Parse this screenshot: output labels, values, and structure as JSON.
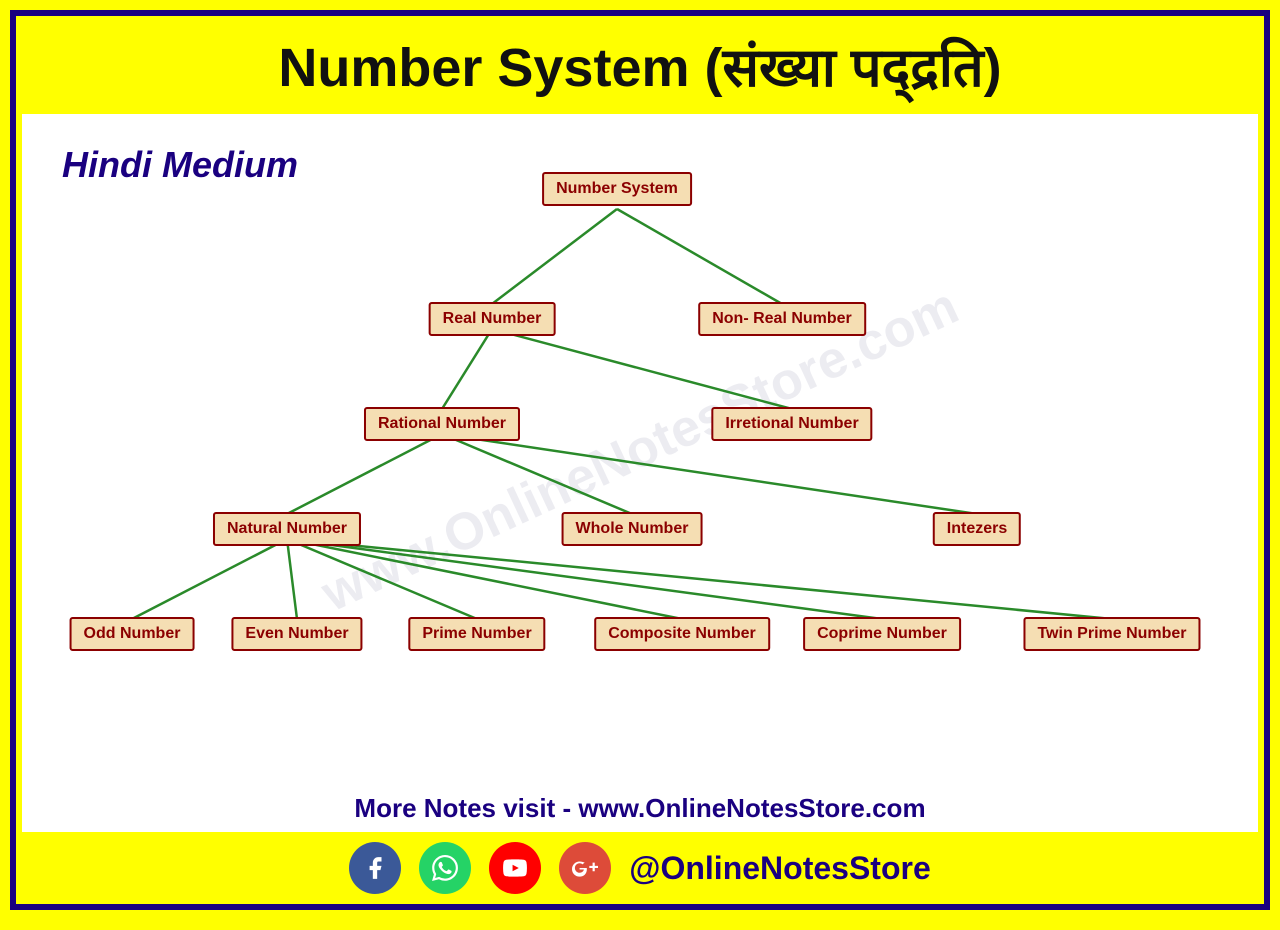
{
  "header": {
    "title": "Number System (संख्या पद्द्रति)"
  },
  "subheading": "Hindi Medium",
  "watermark": "www.OnlineNotesStore.com",
  "footer": {
    "text": "More Notes visit - www.OnlineNotesStore.com"
  },
  "social": {
    "handle": "@OnlineNotesStore",
    "icons": [
      "f",
      "whatsapp",
      "youtube",
      "g+"
    ]
  },
  "nodes": {
    "number_system": "Number System",
    "real_number": "Real Number",
    "non_real_number": "Non- Real Number",
    "rational_number": "Rational Number",
    "irrational_number": "Irretional Number",
    "natural_number": "Natural Number",
    "whole_number": "Whole Number",
    "integers": "Intezers",
    "odd_number": "Odd Number",
    "even_number": "Even Number",
    "prime_number": "Prime Number",
    "composite_number": "Composite Number",
    "coprime_number": "Coprime Number",
    "twin_prime_number": "Twin Prime Number"
  }
}
